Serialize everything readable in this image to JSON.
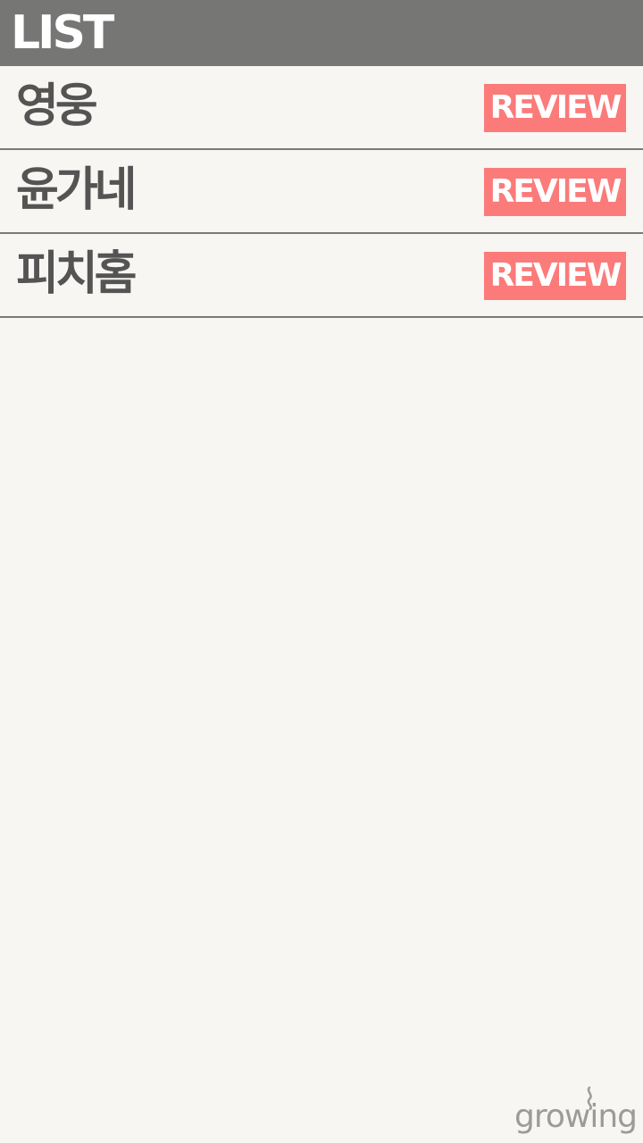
{
  "header": {
    "title": "LIST"
  },
  "list": {
    "items": [
      {
        "name": "영웅",
        "action_label": "REVIEW"
      },
      {
        "name": "윤가네",
        "action_label": "REVIEW"
      },
      {
        "name": "피치홈",
        "action_label": "REVIEW"
      }
    ]
  },
  "logo": {
    "text": "growing"
  },
  "colors": {
    "header_bg": "#767675",
    "page_bg": "#f8f6f2",
    "review_button": "#fb7b7a",
    "item_text": "#545454",
    "divider": "#7a7a78",
    "logo": "#9b9b9b"
  }
}
